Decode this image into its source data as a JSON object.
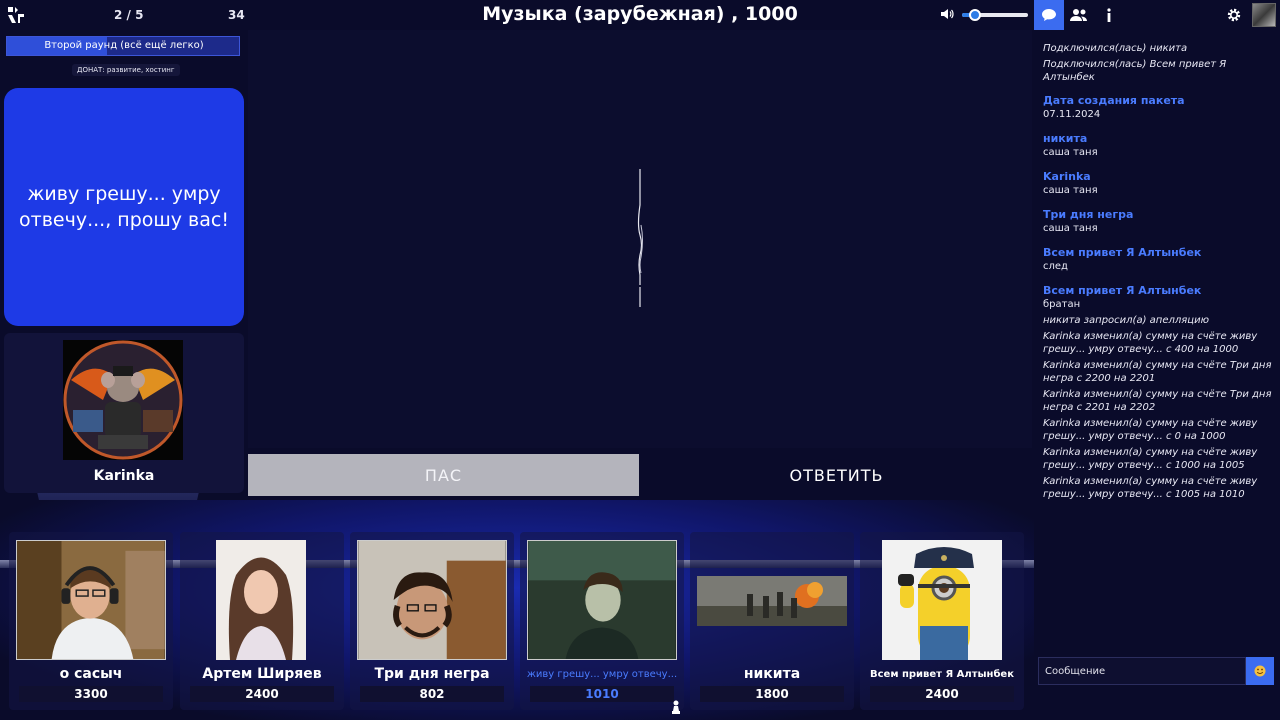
{
  "header": {
    "round_counter": "2 / 5",
    "timer": "34",
    "theme_title": "Музыка (зарубежная) , 1000",
    "volume_percent": 20
  },
  "round": {
    "title": "Второй раунд (всё ещё легко)",
    "progress_percent": 43,
    "donate": "ДОНАТ: развитие, хостинг"
  },
  "question": {
    "text": "живу грешу... умру отвечу..., прошу вас!"
  },
  "showman": {
    "name": "Karinka"
  },
  "buttons": {
    "pass": "ПАС",
    "answer": "ОТВЕТИТЬ"
  },
  "players": [
    {
      "name": "о сасыч",
      "score": "3300"
    },
    {
      "name": "Артем Ширяев",
      "score": "2400"
    },
    {
      "name": "Три дня негра",
      "score": "802"
    },
    {
      "name": "живу грешу... умру отвечу...",
      "score": "1010"
    },
    {
      "name": "никита",
      "score": "1800"
    },
    {
      "name": "Всем привет Я Алтынбек",
      "score": "2400"
    }
  ],
  "chat": {
    "messages": [
      {
        "type": "system",
        "text": "Подключился(лась) никита"
      },
      {
        "type": "system",
        "text": "Подключился(лась) Всем привет Я Алтынбек"
      },
      {
        "type": "author",
        "text": "Дата создания пакета"
      },
      {
        "type": "text",
        "text": "07.11.2024"
      },
      {
        "type": "author",
        "text": "никита"
      },
      {
        "type": "text",
        "text": "саша таня"
      },
      {
        "type": "author",
        "text": "Karinka"
      },
      {
        "type": "text",
        "text": "саша таня"
      },
      {
        "type": "author",
        "text": "Три дня негра"
      },
      {
        "type": "text",
        "text": "саша таня"
      },
      {
        "type": "author",
        "text": "Всем привет Я Алтынбек"
      },
      {
        "type": "text",
        "text": "след"
      },
      {
        "type": "author",
        "text": "Всем привет Я Алтынбек"
      },
      {
        "type": "text",
        "text": "братан"
      },
      {
        "type": "system",
        "text": "никита запросил(а) апелляцию"
      },
      {
        "type": "system",
        "text": "Karinka изменил(а) сумму на счёте живу грешу... умру отвечу... с 400 на 1000"
      },
      {
        "type": "system",
        "text": "Karinka изменил(а) сумму на счёте Три дня негра с 2200 на 2201"
      },
      {
        "type": "system",
        "text": "Karinka изменил(а) сумму на счёте Три дня негра с 2201 на 2202"
      },
      {
        "type": "system",
        "text": "Karinka изменил(а) сумму на счёте живу грешу... умру отвечу... с 0 на 1000"
      },
      {
        "type": "system",
        "text": "Karinka изменил(а) сумму на счёте живу грешу... умру отвечу... с 1000 на 1005"
      },
      {
        "type": "system",
        "text": "Karinka изменил(а) сумму на счёте живу грешу... умру отвечу... с 1005 на 1010"
      }
    ],
    "input_placeholder": "Сообщение"
  },
  "colors": {
    "background": "#0a0b2a",
    "accent": "#3b6cf0",
    "question_card": "#1e3ae6",
    "author_name": "#4a7cff",
    "pass_button": "#b4b4bc"
  },
  "icons": [
    "logo-icon",
    "volume-icon",
    "chat-icon",
    "players-icon",
    "info-icon",
    "gear-icon",
    "emoji-icon",
    "pawn-icon"
  ]
}
